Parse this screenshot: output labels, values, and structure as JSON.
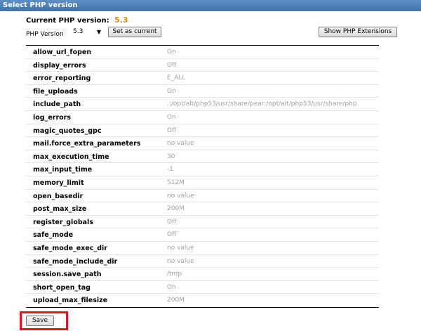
{
  "header": {
    "title": "Select PHP version"
  },
  "current": {
    "label": "Current PHP version:",
    "version": "5.3"
  },
  "controls": {
    "php_version_label": "PHP Version",
    "php_version_selected": "5.3",
    "set_current_label": "Set as current",
    "show_extensions_label": "Show PHP Extensions"
  },
  "options": [
    {
      "name": "allow_url_fopen",
      "value": "On"
    },
    {
      "name": "display_errors",
      "value": "Off"
    },
    {
      "name": "error_reporting",
      "value": "E_ALL"
    },
    {
      "name": "file_uploads",
      "value": "On"
    },
    {
      "name": "include_path",
      "value": ".:/opt/alt/php53/usr/share/pear:/opt/alt/php53/usr/share/php"
    },
    {
      "name": "log_errors",
      "value": "On"
    },
    {
      "name": "magic_quotes_gpc",
      "value": "Off"
    },
    {
      "name": "mail.force_extra_parameters",
      "value": "no value"
    },
    {
      "name": "max_execution_time",
      "value": "30"
    },
    {
      "name": "max_input_time",
      "value": "-1"
    },
    {
      "name": "memory_limit",
      "value": "512M"
    },
    {
      "name": "open_basedir",
      "value": "no value"
    },
    {
      "name": "post_max_size",
      "value": "200M"
    },
    {
      "name": "register_globals",
      "value": "Off"
    },
    {
      "name": "safe_mode",
      "value": "Off"
    },
    {
      "name": "safe_mode_exec_dir",
      "value": "no value"
    },
    {
      "name": "safe_mode_include_dir",
      "value": "no value"
    },
    {
      "name": "session.save_path",
      "value": "/tmp"
    },
    {
      "name": "short_open_tag",
      "value": "On"
    },
    {
      "name": "upload_max_filesize",
      "value": "200M"
    }
  ],
  "footer": {
    "save_label": "Save"
  },
  "colors": {
    "title_bar": "#4a7db8",
    "version_accent": "#e08a1e",
    "highlight": "#e0141a"
  }
}
